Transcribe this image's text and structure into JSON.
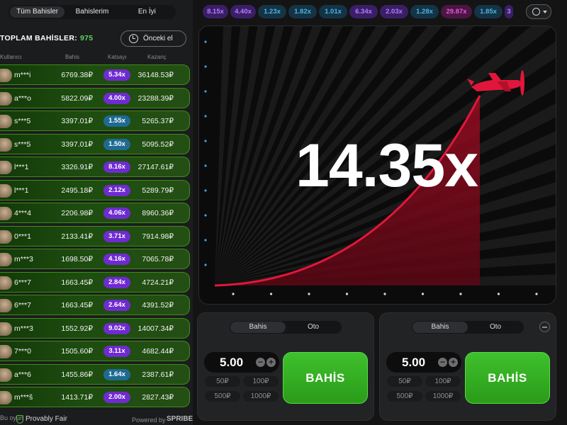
{
  "left_panel": {
    "tabs": [
      "Tüm Bahisler",
      "Bahislerim",
      "En İyi"
    ],
    "total_label": "TOPLAM BAHİSLER:",
    "total_count": "975",
    "prev_button": "Önceki el",
    "columns": [
      "Kullanıcı",
      "Bahis",
      "Katsayı",
      "Kazanç"
    ],
    "rows": [
      {
        "user": "m***i",
        "bet": "6769.38₽",
        "mult": "5.34x",
        "win": "36148.53₽",
        "color": "#6f2bd1"
      },
      {
        "user": "a***o",
        "bet": "5822.09₽",
        "mult": "4.00x",
        "win": "23288.39₽",
        "color": "#6f2bd1"
      },
      {
        "user": "s***5",
        "bet": "3397.01₽",
        "mult": "1.55x",
        "win": "5265.37₽",
        "color": "#1e6a94"
      },
      {
        "user": "s***5",
        "bet": "3397.01₽",
        "mult": "1.50x",
        "win": "5095.52₽",
        "color": "#1e6a94"
      },
      {
        "user": "l***1",
        "bet": "3326.91₽",
        "mult": "8.16x",
        "win": "27147.61₽",
        "color": "#6f2bd1"
      },
      {
        "user": "l***1",
        "bet": "2495.18₽",
        "mult": "2.12x",
        "win": "5289.79₽",
        "color": "#6f2bd1"
      },
      {
        "user": "4***4",
        "bet": "2206.98₽",
        "mult": "4.06x",
        "win": "8960.36₽",
        "color": "#6f2bd1"
      },
      {
        "user": "0***1",
        "bet": "2133.41₽",
        "mult": "3.71x",
        "win": "7914.98₽",
        "color": "#6f2bd1"
      },
      {
        "user": "m***3",
        "bet": "1698.50₽",
        "mult": "4.16x",
        "win": "7065.78₽",
        "color": "#6f2bd1"
      },
      {
        "user": "6***7",
        "bet": "1663.45₽",
        "mult": "2.84x",
        "win": "4724.21₽",
        "color": "#6f2bd1"
      },
      {
        "user": "6***7",
        "bet": "1663.45₽",
        "mult": "2.64x",
        "win": "4391.52₽",
        "color": "#6f2bd1"
      },
      {
        "user": "m***3",
        "bet": "1552.92₽",
        "mult": "9.02x",
        "win": "14007.34₽",
        "color": "#6f2bd1"
      },
      {
        "user": "7***0",
        "bet": "1505.60₽",
        "mult": "3.11x",
        "win": "4682.44₽",
        "color": "#6f2bd1"
      },
      {
        "user": "a***6",
        "bet": "1455.86₽",
        "mult": "1.64x",
        "win": "2387.61₽",
        "color": "#1e6a94"
      },
      {
        "user": "m***š",
        "bet": "1413.71₽",
        "mult": "2.00x",
        "win": "2827.43₽",
        "color": "#6f2bd1"
      }
    ],
    "footer": {
      "left": "Bu oyun",
      "fair": "Provably Fair",
      "powered": "Powered by",
      "brand": "SPRIBE"
    }
  },
  "history": [
    {
      "v": "8.15x",
      "color": "#b57cff",
      "bg": "#3a1f66"
    },
    {
      "v": "4.40x",
      "color": "#b57cff",
      "bg": "#3a1f66"
    },
    {
      "v": "1.23x",
      "color": "#4cb3e6",
      "bg": "#143446"
    },
    {
      "v": "1.82x",
      "color": "#4cb3e6",
      "bg": "#143446"
    },
    {
      "v": "1.01x",
      "color": "#4cb3e6",
      "bg": "#143446"
    },
    {
      "v": "6.34x",
      "color": "#b57cff",
      "bg": "#3a1f66"
    },
    {
      "v": "2.03x",
      "color": "#b57cff",
      "bg": "#3a1f66"
    },
    {
      "v": "1.28x",
      "color": "#4cb3e6",
      "bg": "#143446"
    },
    {
      "v": "29.87x",
      "color": "#e35ae3",
      "bg": "#4b1642"
    },
    {
      "v": "1.85x",
      "color": "#4cb3e6",
      "bg": "#143446"
    },
    {
      "v": "3",
      "color": "#b57cff",
      "bg": "#3a1f66"
    }
  ],
  "game": {
    "multiplier": "14.35x",
    "curve_color": "#e0173a"
  },
  "panels": [
    {
      "tabs": [
        "Bahis",
        "Oto"
      ],
      "amount": "5.00",
      "quick": [
        "50₽",
        "100₽",
        "500₽",
        "1000₽"
      ],
      "button": "BAHİS"
    },
    {
      "tabs": [
        "Bahis",
        "Oto"
      ],
      "amount": "5.00",
      "quick": [
        "50₽",
        "100₽",
        "500₽",
        "1000₽"
      ],
      "button": "BAHİS"
    }
  ]
}
